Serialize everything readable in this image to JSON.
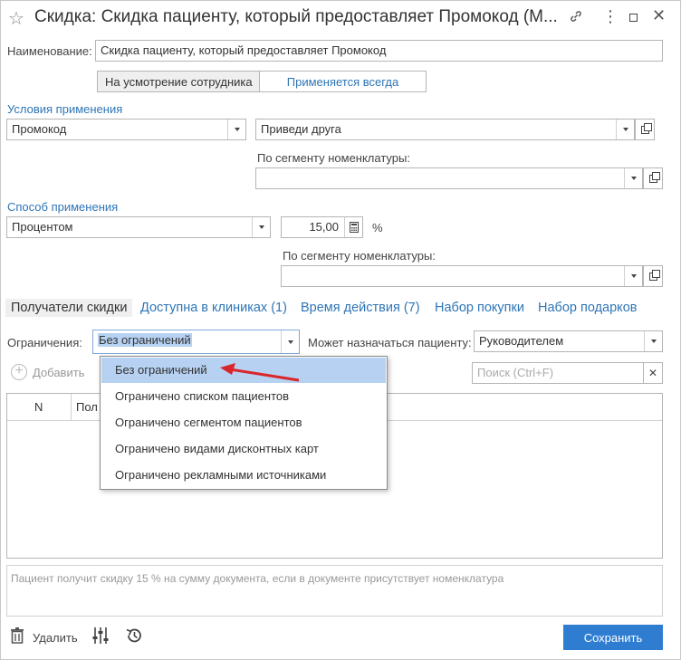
{
  "window": {
    "title": "Скидка: Скидка пациенту, который предоставляет Промокод (М...",
    "icons": [
      "star-icon",
      "link-icon",
      "more-icon",
      "maximize-icon",
      "close-icon"
    ]
  },
  "form": {
    "name_label": "Наименование:",
    "name_value": "Скидка пациенту, который предоставляет Промокод",
    "mode_options": [
      "На усмотрение сотрудника",
      "Применяется всегда"
    ],
    "mode_selected": "Применяется всегда"
  },
  "conditions": {
    "title": "Условия применения",
    "condition_value": "Промокод",
    "promo_value": "Приведи друга",
    "segment_label": "По сегменту номенклатуры:",
    "segment_value": ""
  },
  "method": {
    "title": "Способ применения",
    "method_value": "Процентом",
    "amount_value": "15,00",
    "unit": "%",
    "segment_label": "По сегменту номенклатуры:",
    "segment_value": ""
  },
  "tabs": [
    {
      "label": "Получатели скидки",
      "active": true
    },
    {
      "label": "Доступна в клиниках (1)",
      "active": false
    },
    {
      "label": "Время действия (7)",
      "active": false
    },
    {
      "label": "Набор покупки",
      "active": false
    },
    {
      "label": "Набор подарков",
      "active": false
    }
  ],
  "recipients": {
    "restriction_label": "Ограничения:",
    "restriction_value": "Без ограничений",
    "assign_label": "Может назначаться пациенту:",
    "assign_value": "Руководителем",
    "add_label": "Добавить",
    "search_placeholder": "Поиск (Ctrl+F)",
    "table_headers": [
      "N",
      "Пол"
    ]
  },
  "popup": {
    "items": [
      "Без ограничений",
      "Ограничено списком пациентов",
      "Ограничено сегментом пациентов",
      "Ограничено видами дисконтных карт",
      "Ограничено рекламными источниками"
    ],
    "selected_index": 0,
    "accent": "#b6d1f1"
  },
  "footer": {
    "note": "Пациент получит скидку 15 % на сумму документа, если в документе присутствует номенклатура",
    "delete_label": "Удалить",
    "save_label": "Сохранить"
  },
  "colors": {
    "link": "#2e75b6",
    "save_button": "#2f7dd1",
    "arrow": "#d9262c"
  }
}
